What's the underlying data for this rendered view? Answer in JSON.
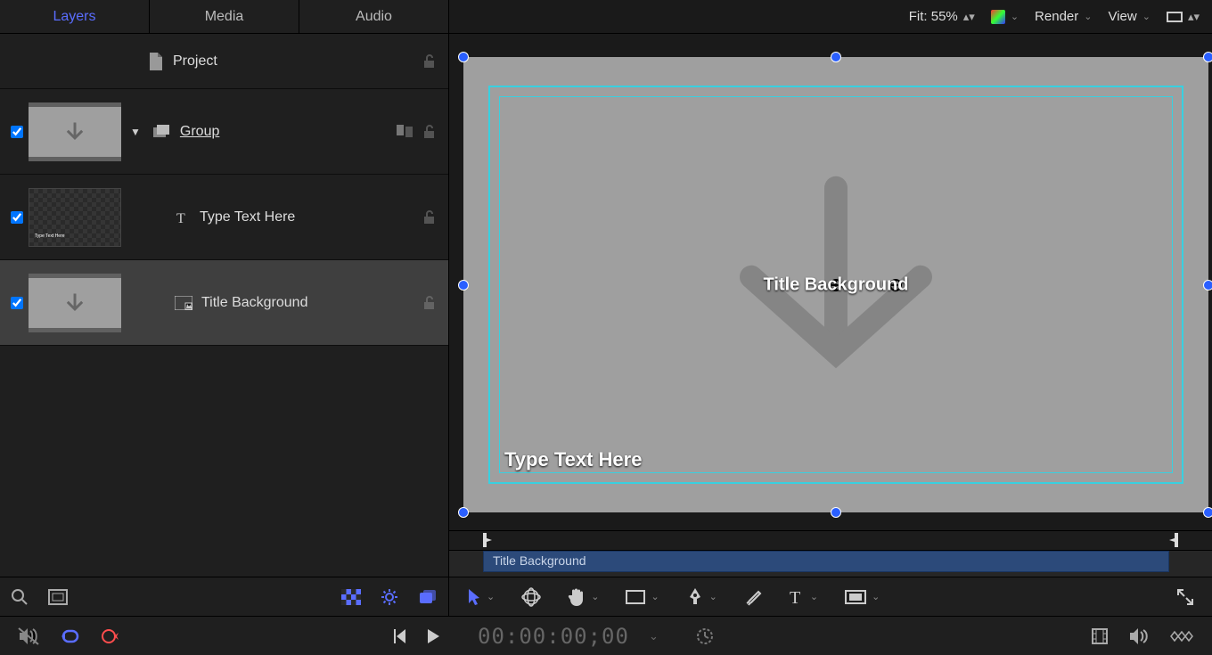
{
  "tabs": {
    "layers": "Layers",
    "media": "Media",
    "audio": "Audio"
  },
  "layers": {
    "project": "Project",
    "group": "Group",
    "text": "Type Text Here",
    "title_bg": "Title Background"
  },
  "canvas_toolbar": {
    "fit": "Fit: 55%",
    "render": "Render",
    "view": "View"
  },
  "canvas": {
    "title_label": "Title Background",
    "type_label": "Type Text Here"
  },
  "mini_timeline": {
    "clip": "Title Background"
  },
  "transport": {
    "timecode": "00:00:00;00"
  }
}
